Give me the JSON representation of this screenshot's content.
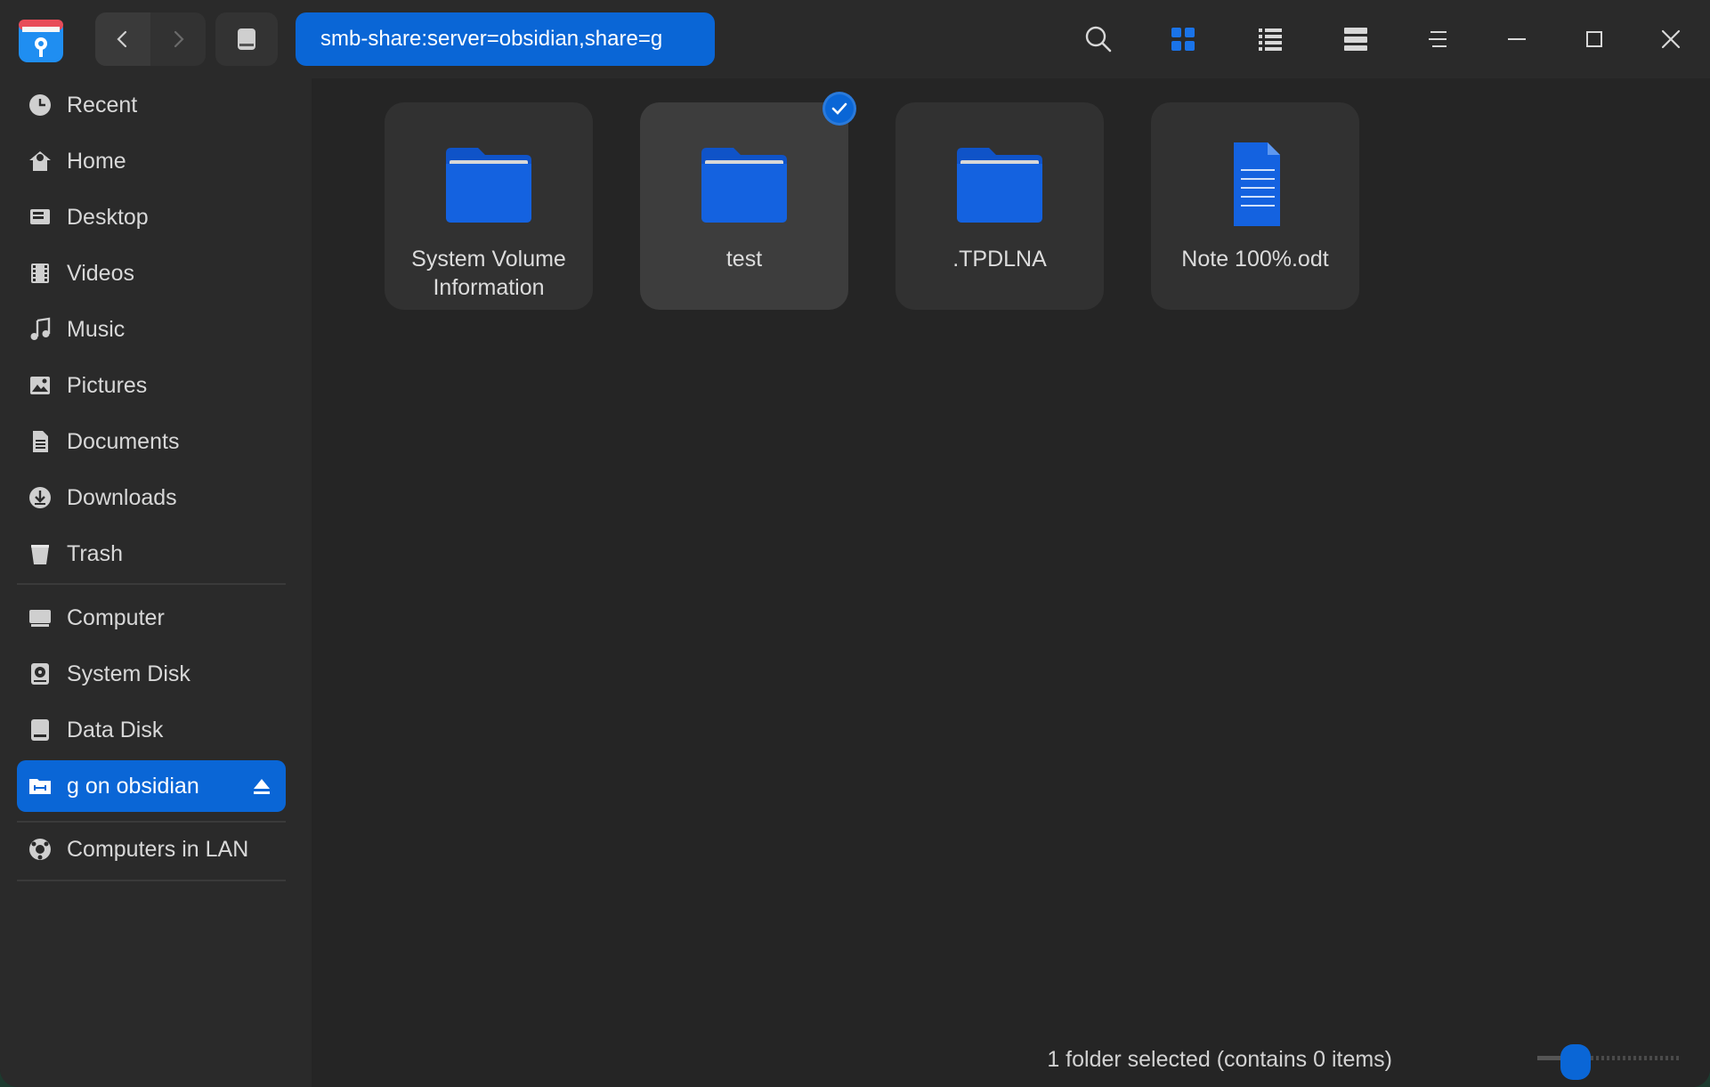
{
  "toolbar": {
    "address": "smb-share:server=obsidian,share=g",
    "icons": [
      "search-icon",
      "icon-view-icon",
      "list-view-icon",
      "tree-view-icon",
      "menu-icon",
      "minimize-icon",
      "maximize-icon",
      "close-icon"
    ]
  },
  "sidebar": {
    "items": [
      {
        "label": "Recent",
        "icon": "clock-icon"
      },
      {
        "label": "Home",
        "icon": "home-icon"
      },
      {
        "label": "Desktop",
        "icon": "desktop-icon"
      },
      {
        "label": "Videos",
        "icon": "film-icon"
      },
      {
        "label": "Music",
        "icon": "music-icon"
      },
      {
        "label": "Pictures",
        "icon": "picture-icon"
      },
      {
        "label": "Documents",
        "icon": "document-icon"
      },
      {
        "label": "Downloads",
        "icon": "download-icon"
      },
      {
        "label": "Trash",
        "icon": "trash-icon"
      },
      {
        "label": "Computer",
        "icon": "computer-icon"
      },
      {
        "label": "System Disk",
        "icon": "system-disk-icon"
      },
      {
        "label": "Data Disk",
        "icon": "disk-icon"
      },
      {
        "label": "g on obsidian",
        "icon": "network-folder-icon"
      },
      {
        "label": "Computers in LAN",
        "icon": "lan-icon"
      }
    ],
    "active": "g on obsidian"
  },
  "files": [
    {
      "name": "System Volume Information",
      "type": "folder",
      "selected": false
    },
    {
      "name": "test",
      "type": "folder",
      "selected": true
    },
    {
      "name": ".TPDLNA",
      "type": "folder",
      "selected": false
    },
    {
      "name": "Note 100%.odt",
      "type": "document",
      "selected": false
    }
  ],
  "status": {
    "text": "1 folder selected (contains 0 items)",
    "zoom_level": 0.2
  },
  "colors": {
    "accent": "#0a66d6",
    "folder": "#1462e0",
    "background": "#252525",
    "sidebar": "#2a2a2a"
  }
}
